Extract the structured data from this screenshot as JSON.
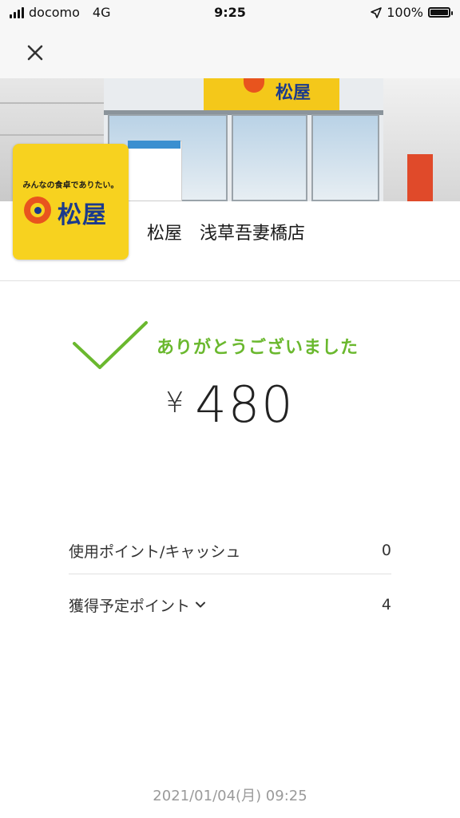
{
  "status_bar": {
    "carrier": "docomo",
    "network": "4G",
    "time": "9:25",
    "battery": "100%",
    "battery_level": 1.0
  },
  "nav": {
    "close_icon": "close-icon"
  },
  "banner": {
    "sign_text": "松屋"
  },
  "store": {
    "logo_tagline": "みんなの食卓でありたい。",
    "logo_name": "松屋",
    "name": "松屋　浅草吾妻橋店"
  },
  "payment": {
    "thanks": "ありがとうございました",
    "currency": "¥",
    "amount": "480"
  },
  "points": {
    "used_label": "使用ポイント/キャッシュ",
    "used_value": "0",
    "earned_label": "獲得予定ポイント",
    "earned_value": "4"
  },
  "timestamp": "2021/01/04(月) 09:25",
  "colors": {
    "accent_green": "#6ab82e",
    "logo_yellow": "#f7d21f",
    "logo_blue": "#1b3a8c",
    "logo_orange": "#e8541e"
  }
}
